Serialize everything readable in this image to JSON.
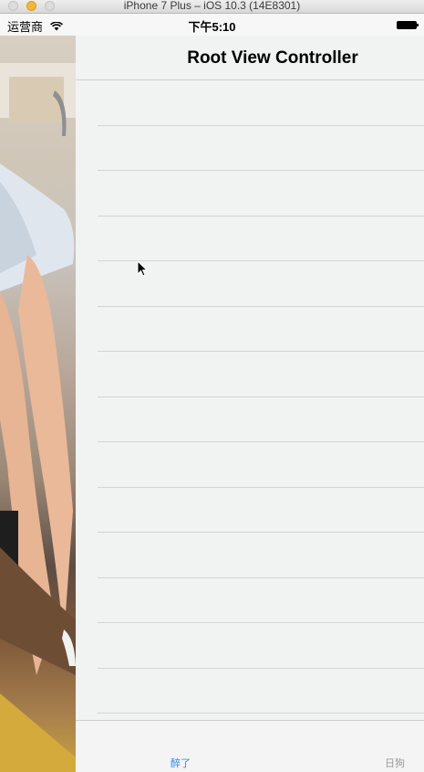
{
  "simulator": {
    "window_title": "iPhone 7 Plus – iOS 10.3 (14E8301)"
  },
  "status_bar": {
    "carrier": "运营商",
    "time": "下午5:10",
    "wifi_icon": "wifi-icon",
    "battery_icon": "battery-icon"
  },
  "nav_bar": {
    "title": "Root View Controller"
  },
  "table": {
    "row_count": 14
  },
  "tab_bar": {
    "tabs": [
      {
        "label": "醉了",
        "selected": true,
        "color": "#2a86f0"
      },
      {
        "label": "日狗",
        "selected": false,
        "color": "#9a9a9a"
      }
    ]
  },
  "side_panel": {
    "content": "photo"
  },
  "colors": {
    "background": "#f1f2f2",
    "separator": "#d4d4d4",
    "accent": "#2a86f0"
  }
}
